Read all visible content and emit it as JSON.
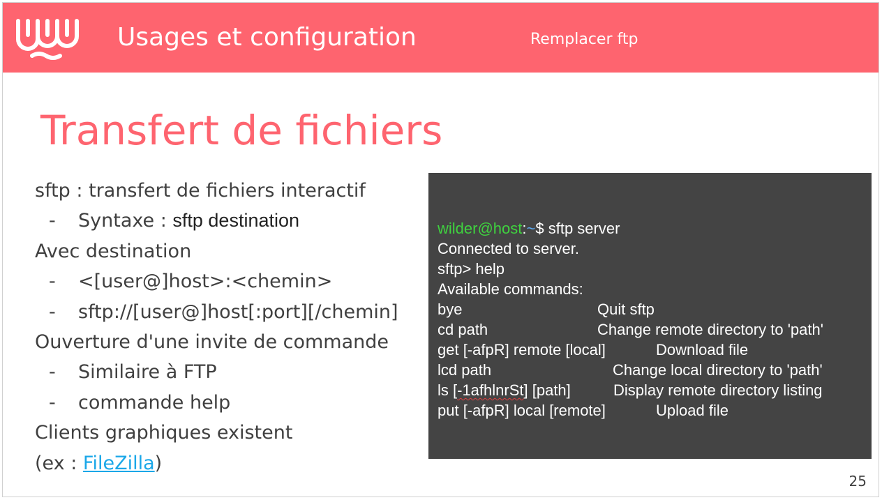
{
  "header": {
    "title": "Usages et configuration",
    "subtitle": "Remplacer ftp",
    "logo_icon": "wild-code-school-logo-icon"
  },
  "slide": {
    "title": "Transfert de fichiers",
    "page_number": "25"
  },
  "bullets": [
    {
      "text": "sftp : transfert de fichiers interactif"
    },
    {
      "dash": "-",
      "prefix": "Syntaxe : ",
      "code": "sftp destination"
    },
    {
      "text": "Avec destination"
    },
    {
      "dash": "-",
      "text": "<[user@]host>:<chemin>"
    },
    {
      "dash": "-",
      "text": "sftp://[user@]host[:port][/chemin]"
    },
    {
      "text": "Ouverture d'une invite de commande"
    },
    {
      "dash": "-",
      "text": "Similaire à FTP"
    },
    {
      "dash": "-",
      "text": "commande help"
    },
    {
      "text": "Clients graphiques existent"
    },
    {
      "prefix": "(ex : ",
      "link": "FileZilla",
      "suffix": ")"
    }
  ],
  "terminal": {
    "prompt_user": "wilder@host",
    "prompt_colon": ":",
    "prompt_path": "~",
    "prompt_cmd": "$ sftp server",
    "lines": [
      "Connected to server.",
      "sftp> help",
      "Available commands:"
    ],
    "commands": [
      {
        "cmd": "bye",
        "desc": "Quit sftp"
      },
      {
        "cmd": "cd path",
        "desc": "Change remote directory to 'path'"
      },
      {
        "cmd": "get [-afpR] remote [local]",
        "desc": "Download file"
      },
      {
        "cmd": "lcd path",
        "desc": "Change local directory to 'path'"
      },
      {
        "cmd_pre": "ls [",
        "cmd_flag": "-1afhlnrSt",
        "cmd_post": "] [path]",
        "desc": "Display remote directory listing"
      },
      {
        "cmd": "put [-afpR] local [remote]",
        "desc": "Upload file"
      }
    ]
  },
  "colors": {
    "brand": "#fe646f",
    "terminal_bg": "#444444",
    "prompt_user": "#3fd23f",
    "prompt_path": "#5aa9f0",
    "link": "#1aa7e8"
  }
}
